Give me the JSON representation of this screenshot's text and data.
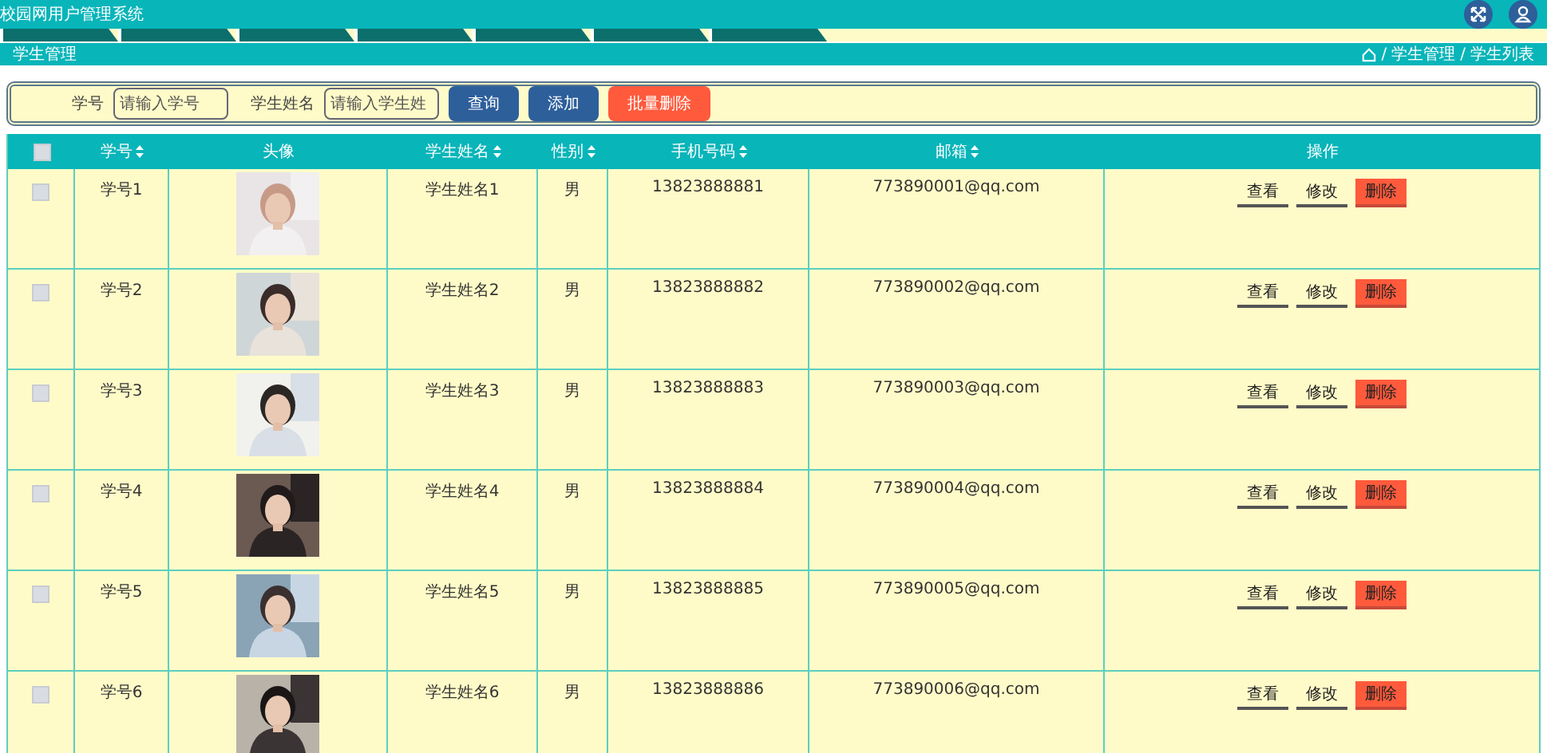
{
  "app_title": "校园网用户管理系统",
  "page_title": "学生管理",
  "breadcrumb": [
    {
      "label": "学生管理",
      "separator": "/"
    },
    {
      "label": "学生列表",
      "separator": "/"
    }
  ],
  "search": {
    "fields": [
      {
        "label": "学号",
        "placeholder": "请输入学号"
      },
      {
        "label": "学生姓名",
        "placeholder": "请输入学生姓"
      }
    ],
    "buttons": [
      {
        "label": "查询",
        "kind": "primary"
      },
      {
        "label": "添加",
        "kind": "primary"
      },
      {
        "label": "批量删除",
        "kind": "danger"
      }
    ]
  },
  "table": {
    "select_all": {
      "checked": false
    },
    "columns": [
      {
        "label": "学号",
        "sortable": true
      },
      {
        "label": "头像",
        "sortable": false
      },
      {
        "label": "学生姓名",
        "sortable": true
      },
      {
        "label": "性别",
        "sortable": true
      },
      {
        "label": "手机号码",
        "sortable": true
      },
      {
        "label": "邮箱",
        "sortable": true
      },
      {
        "label": "操作",
        "sortable": false
      }
    ],
    "rows": [
      {
        "checked": false,
        "id": "学号1",
        "name": "学生姓名1",
        "gender": "男",
        "phone": "13823888881",
        "email": "773890001@qq.com",
        "actions": [
          {
            "label": "查看",
            "kind": "plain"
          },
          {
            "label": "修改",
            "kind": "plain"
          },
          {
            "label": "删除",
            "kind": "danger"
          }
        ]
      },
      {
        "checked": false,
        "id": "学号2",
        "name": "学生姓名2",
        "gender": "男",
        "phone": "13823888882",
        "email": "773890002@qq.com",
        "actions": [
          {
            "label": "查看",
            "kind": "plain"
          },
          {
            "label": "修改",
            "kind": "plain"
          },
          {
            "label": "删除",
            "kind": "danger"
          }
        ]
      },
      {
        "checked": false,
        "id": "学号3",
        "name": "学生姓名3",
        "gender": "男",
        "phone": "13823888883",
        "email": "773890003@qq.com",
        "actions": [
          {
            "label": "查看",
            "kind": "plain"
          },
          {
            "label": "修改",
            "kind": "plain"
          },
          {
            "label": "删除",
            "kind": "danger"
          }
        ]
      },
      {
        "checked": false,
        "id": "学号4",
        "name": "学生姓名4",
        "gender": "男",
        "phone": "13823888884",
        "email": "773890004@qq.com",
        "actions": [
          {
            "label": "查看",
            "kind": "plain"
          },
          {
            "label": "修改",
            "kind": "plain"
          },
          {
            "label": "删除",
            "kind": "danger"
          }
        ]
      },
      {
        "checked": false,
        "id": "学号5",
        "name": "学生姓名5",
        "gender": "男",
        "phone": "13823888885",
        "email": "773890005@qq.com",
        "actions": [
          {
            "label": "查看",
            "kind": "plain"
          },
          {
            "label": "修改",
            "kind": "plain"
          },
          {
            "label": "删除",
            "kind": "danger"
          }
        ]
      },
      {
        "checked": false,
        "id": "学号6",
        "name": "学生姓名6",
        "gender": "男",
        "phone": "13823888886",
        "email": "773890006@qq.com",
        "actions": [
          {
            "label": "查看",
            "kind": "plain"
          },
          {
            "label": "修改",
            "kind": "plain"
          },
          {
            "label": "删除",
            "kind": "danger"
          }
        ]
      }
    ]
  }
}
